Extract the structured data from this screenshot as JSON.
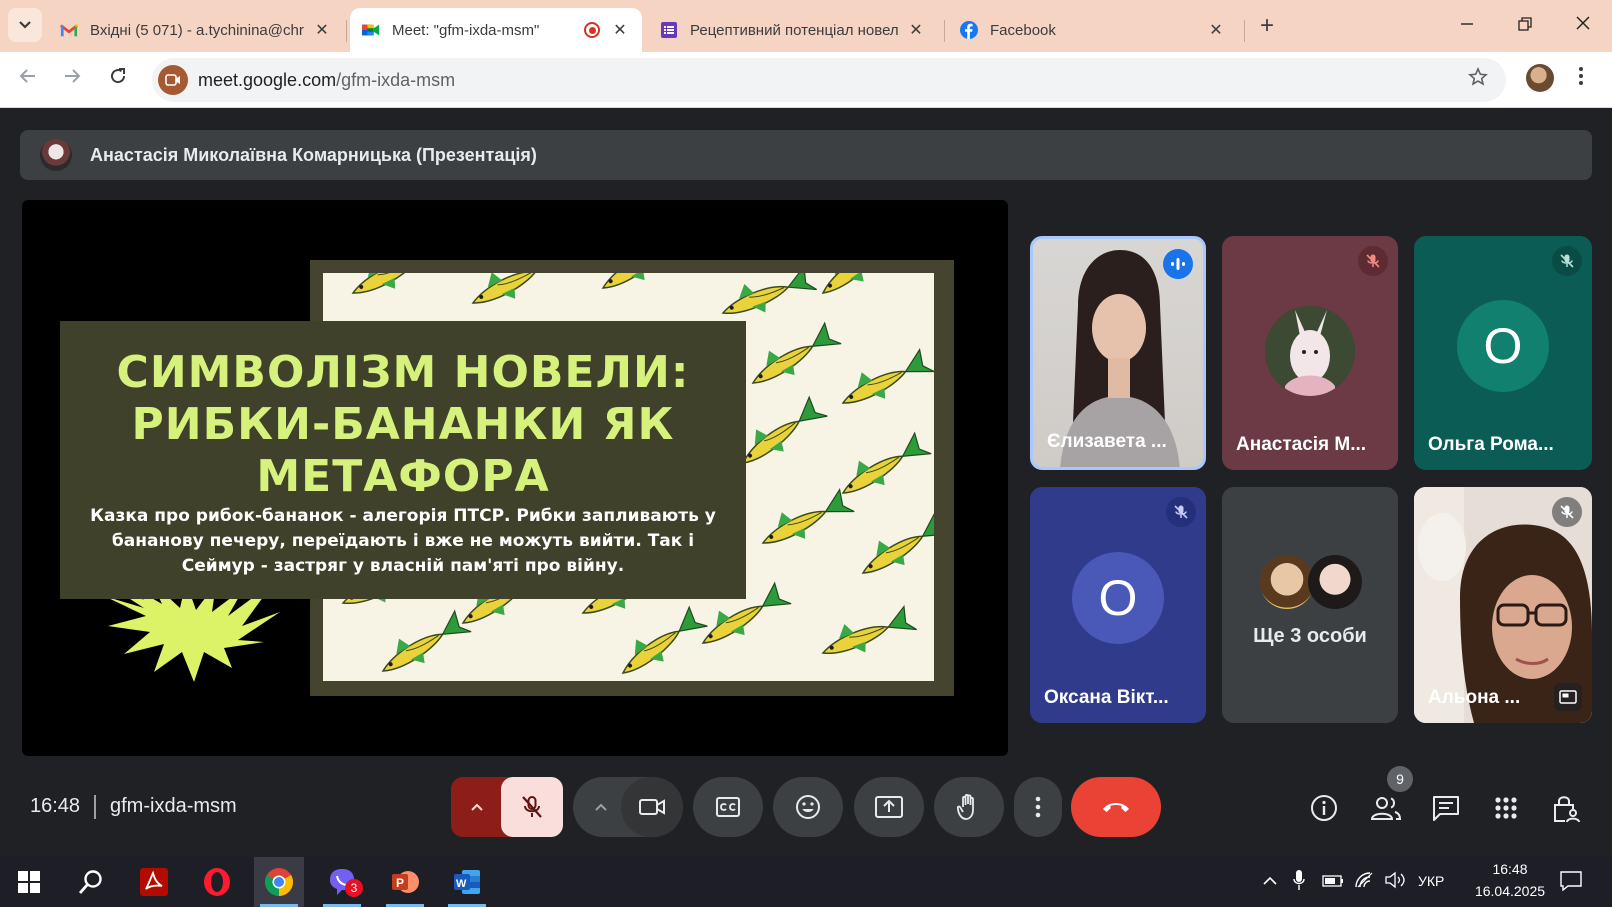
{
  "browser": {
    "tabs": [
      {
        "title": "Вхідні (5 071) - a.tychinina@chr",
        "icon": "gmail-icon",
        "active": false
      },
      {
        "title": "Meet: \"gfm-ixda-msm\"",
        "icon": "meet-icon",
        "active": true,
        "recording": true
      },
      {
        "title": "Рецептивний потенціал новел",
        "icon": "forms-icon",
        "active": false
      },
      {
        "title": "Facebook",
        "icon": "facebook-icon",
        "active": false
      }
    ],
    "close_glyph": "✕",
    "new_tab_glyph": "+",
    "url_host": "meet.google.com",
    "url_path": "/gfm-ixda-msm"
  },
  "meet": {
    "presenter_bar": "Анастасія Миколаївна Комарницька (Презентація)",
    "slide": {
      "title": "СИМВОЛІЗМ НОВЕЛИ: РИБКИ-БАНАНКИ ЯК МЕТАФОРА",
      "body": "Казка про рибок-бананок - алегорія ПТСР. Рибки запливають у бананову печеру, переїдають і вже не можуть вийти. Так і Сеймур - застряг у власній пам'яті про війну."
    },
    "participants": [
      {
        "name": "Єлизавета ...",
        "status": "speaking",
        "type": "video"
      },
      {
        "name": "Анастасія М...",
        "status": "muted",
        "type": "avatar"
      },
      {
        "name": "Ольга Рома...",
        "status": "muted",
        "type": "letter",
        "letter": "О"
      },
      {
        "name": "Оксана Вікт...",
        "status": "muted",
        "type": "letter",
        "letter": "О"
      },
      {
        "name": "Ще 3 особи",
        "status": "",
        "type": "group"
      },
      {
        "name": "Альона ...",
        "status": "muted",
        "type": "video"
      }
    ],
    "time": "16:48",
    "meeting_code": "gfm-ixda-msm",
    "people_count": "9",
    "colors": {
      "end_call": "#ea4335",
      "mic_off_bg": "#f9dedc",
      "mic_pill": "#8c1d18",
      "speaking_border": "#a8c7fa"
    }
  },
  "taskbar": {
    "apps": [
      "windows-start-icon",
      "search-icon",
      "acrobat-icon",
      "opera-icon",
      "chrome-icon",
      "viber-icon",
      "powerpoint-icon",
      "word-icon"
    ],
    "viber_badge": "3",
    "language": "УКР",
    "clock_time": "16:48",
    "clock_date": "16.04.2025"
  }
}
